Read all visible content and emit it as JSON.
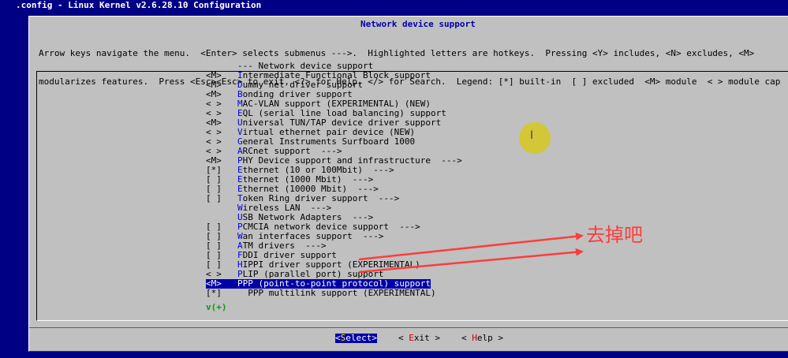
{
  "window": {
    "title": ".config - Linux Kernel v2.6.28.10 Configuration"
  },
  "dialog": {
    "title": "Network device support",
    "help_lines": [
      "Arrow keys navigate the menu.  <Enter> selects submenus --->.  Highlighted letters are hotkeys.  Pressing <Y> includes, <N> excludes, <M>",
      "modularizes features.  Press <Esc><Esc> to exit, <?> for Help, </> for Search.  Legend: [*] built-in  [ ] excluded  <M> module  < > module cap"
    ]
  },
  "menu": {
    "items": [
      {
        "state": "",
        "hot": "",
        "rest": "--- Network device support"
      },
      {
        "state": "<M>",
        "hot": "I",
        "rest": "ntermediate Functional Block support"
      },
      {
        "state": "<M>",
        "hot": "D",
        "rest": "ummy net driver support"
      },
      {
        "state": "<M>",
        "hot": "B",
        "rest": "onding driver support"
      },
      {
        "state": "< >",
        "hot": "M",
        "rest": "AC-VLAN support (EXPERIMENTAL) (NEW)"
      },
      {
        "state": "< >",
        "hot": "E",
        "rest": "QL (serial line load balancing) support"
      },
      {
        "state": "<M>",
        "hot": "U",
        "rest": "niversal TUN/TAP device driver support"
      },
      {
        "state": "< >",
        "hot": "V",
        "rest": "irtual ethernet pair device (NEW)"
      },
      {
        "state": "< >",
        "hot": "G",
        "rest": "eneral Instruments Surfboard 1000"
      },
      {
        "state": "< >",
        "hot": "A",
        "rest": "RCnet support  --->"
      },
      {
        "state": "<M>",
        "hot": "P",
        "rest": "HY Device support and infrastructure  --->"
      },
      {
        "state": "[*]",
        "hot": "E",
        "rest": "thernet (10 or 100Mbit)  --->"
      },
      {
        "state": "[ ]",
        "hot": "E",
        "rest": "thernet (1000 Mbit)  --->"
      },
      {
        "state": "[ ]",
        "hot": "E",
        "rest": "thernet (10000 Mbit)  --->"
      },
      {
        "state": "[ ]",
        "hot": "T",
        "rest": "oken Ring driver support  --->"
      },
      {
        "state": "",
        "hot": "W",
        "rest": "ireless LAN  --->"
      },
      {
        "state": "",
        "hot": "U",
        "rest": "SB Network Adapters  --->"
      },
      {
        "state": "[ ]",
        "hot": "P",
        "rest": "CMCIA network device support  --->"
      },
      {
        "state": "[ ]",
        "hot": "W",
        "rest": "an interfaces support  --->"
      },
      {
        "state": "[ ]",
        "hot": "A",
        "rest": "TM drivers  --->"
      },
      {
        "state": "[ ]",
        "hot": "F",
        "rest": "DDI driver support"
      },
      {
        "state": "[ ]",
        "hot": "H",
        "rest": "IPPI driver support (EXPERIMENTAL)"
      },
      {
        "state": "< >",
        "hot": "P",
        "rest": "LIP (parallel port) support"
      },
      {
        "state": "<M>",
        "hot": "P",
        "rest": "PP (point-to-point protocol) support",
        "selected": true
      },
      {
        "state": "[*]",
        "hot": "",
        "rest": "  PPP multilink support (EXPERIMENTAL)"
      }
    ],
    "more_indicator": "v(+)"
  },
  "buttons": {
    "select": {
      "open": "<",
      "hot": "S",
      "rest": "elect>"
    },
    "exit": {
      "open": "< ",
      "hot": "E",
      "rest": "xit >"
    },
    "help": {
      "open": "< ",
      "hot": "H",
      "rest": "elp >"
    }
  },
  "annotation": {
    "text": "去掉吧",
    "color": "#ff3c3c"
  },
  "cursor": {
    "glyph": "I"
  },
  "colors": {
    "background": "#000084",
    "dialog": "#c0c0c0",
    "selection": "#0000a8",
    "hotkey": "#0000d8"
  }
}
